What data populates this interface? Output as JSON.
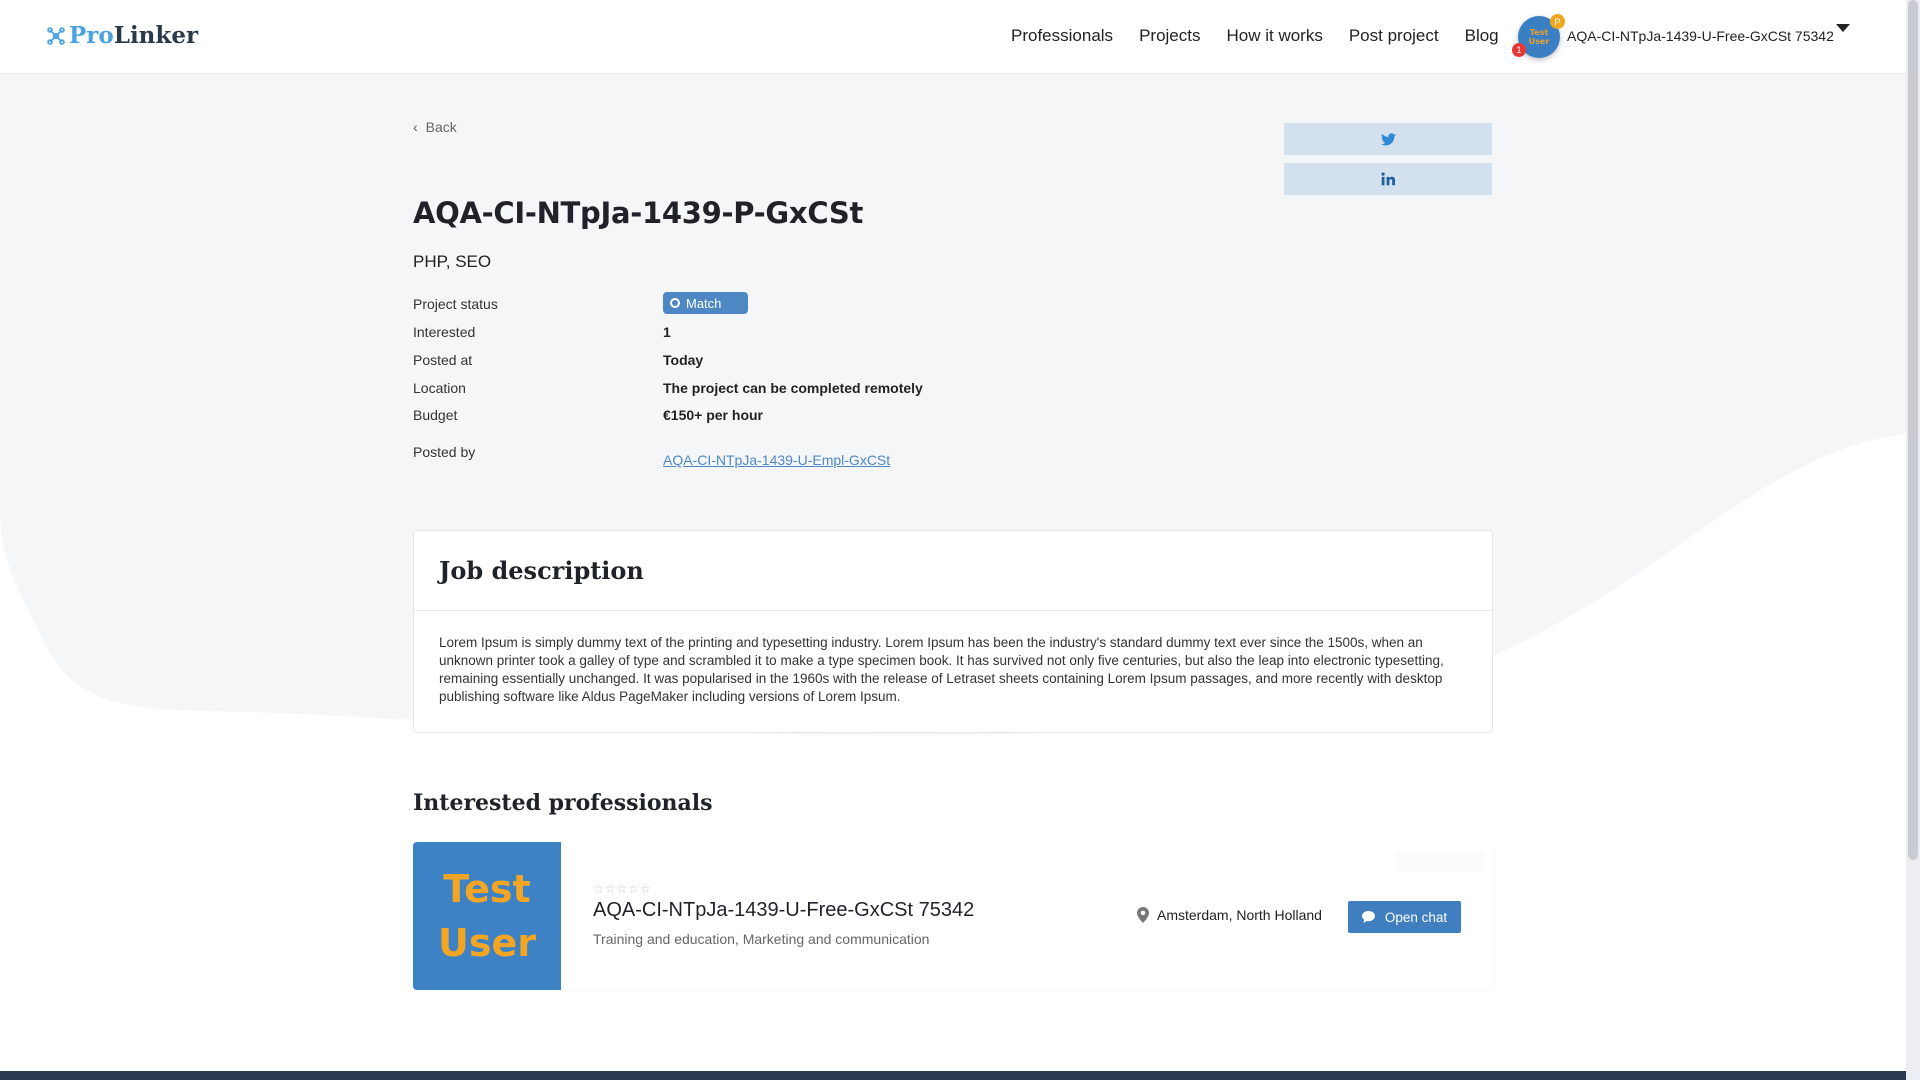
{
  "header": {
    "logo_pro": "Pro",
    "logo_linker": "Linker",
    "nav": [
      "Professionals",
      "Projects",
      "How it works",
      "Post project",
      "Blog"
    ],
    "avatar_line1": "Test",
    "avatar_line2": "User",
    "notification_count": "1",
    "premium_badge": "P",
    "user_name": "AQA-CI-NTpJa-1439-U-Free-GxCSt 75342"
  },
  "back_label": "Back",
  "share": {
    "twitter_icon": "twitter-icon",
    "linkedin_icon": "linkedin-icon"
  },
  "project": {
    "title": "AQA-CI-NTpJa-1439-P-GxCSt",
    "skills": "PHP, SEO",
    "labels": {
      "status": "Project status",
      "interested": "Interested",
      "posted_at": "Posted at",
      "location": "Location",
      "budget": "Budget",
      "posted_by": "Posted by"
    },
    "status": "Match",
    "interested": "1",
    "posted_at": "Today",
    "location": "The project can be completed remotely",
    "budget": "€150+ per hour",
    "posted_by": "AQA-CI-NTpJa-1439-U-Empl-GxCSt"
  },
  "job_description": {
    "title": "Job description",
    "text": "Lorem Ipsum is simply dummy text of the printing and typesetting industry. Lorem Ipsum has been the industry's standard dummy text ever since the 1500s, when an unknown printer took a galley of type and scrambled it to make a type specimen book. It has survived not only five centuries, but also the leap into electronic typesetting, remaining essentially unchanged. It was popularised in the 1960s with the release of Letraset sheets containing Lorem Ipsum passages, and more recently with desktop publishing software like Aldus PageMaker including versions of Lorem Ipsum."
  },
  "interested_professionals": {
    "title": "Interested professionals",
    "items": [
      {
        "image_line1": "Test",
        "image_line2": "User",
        "stars": "☆☆☆☆☆",
        "name": "AQA-CI-NTpJa-1439-U-Free-GxCSt 75342",
        "categories": "Training and education, Marketing and communication",
        "location": "Amsterdam, North Holland",
        "chat_label": "Open chat"
      }
    ]
  },
  "colors": {
    "accent": "#4d88c4",
    "button": "#3f7fbf",
    "share_bg": "#d3e1ef",
    "footer": "#2b3b4f"
  }
}
